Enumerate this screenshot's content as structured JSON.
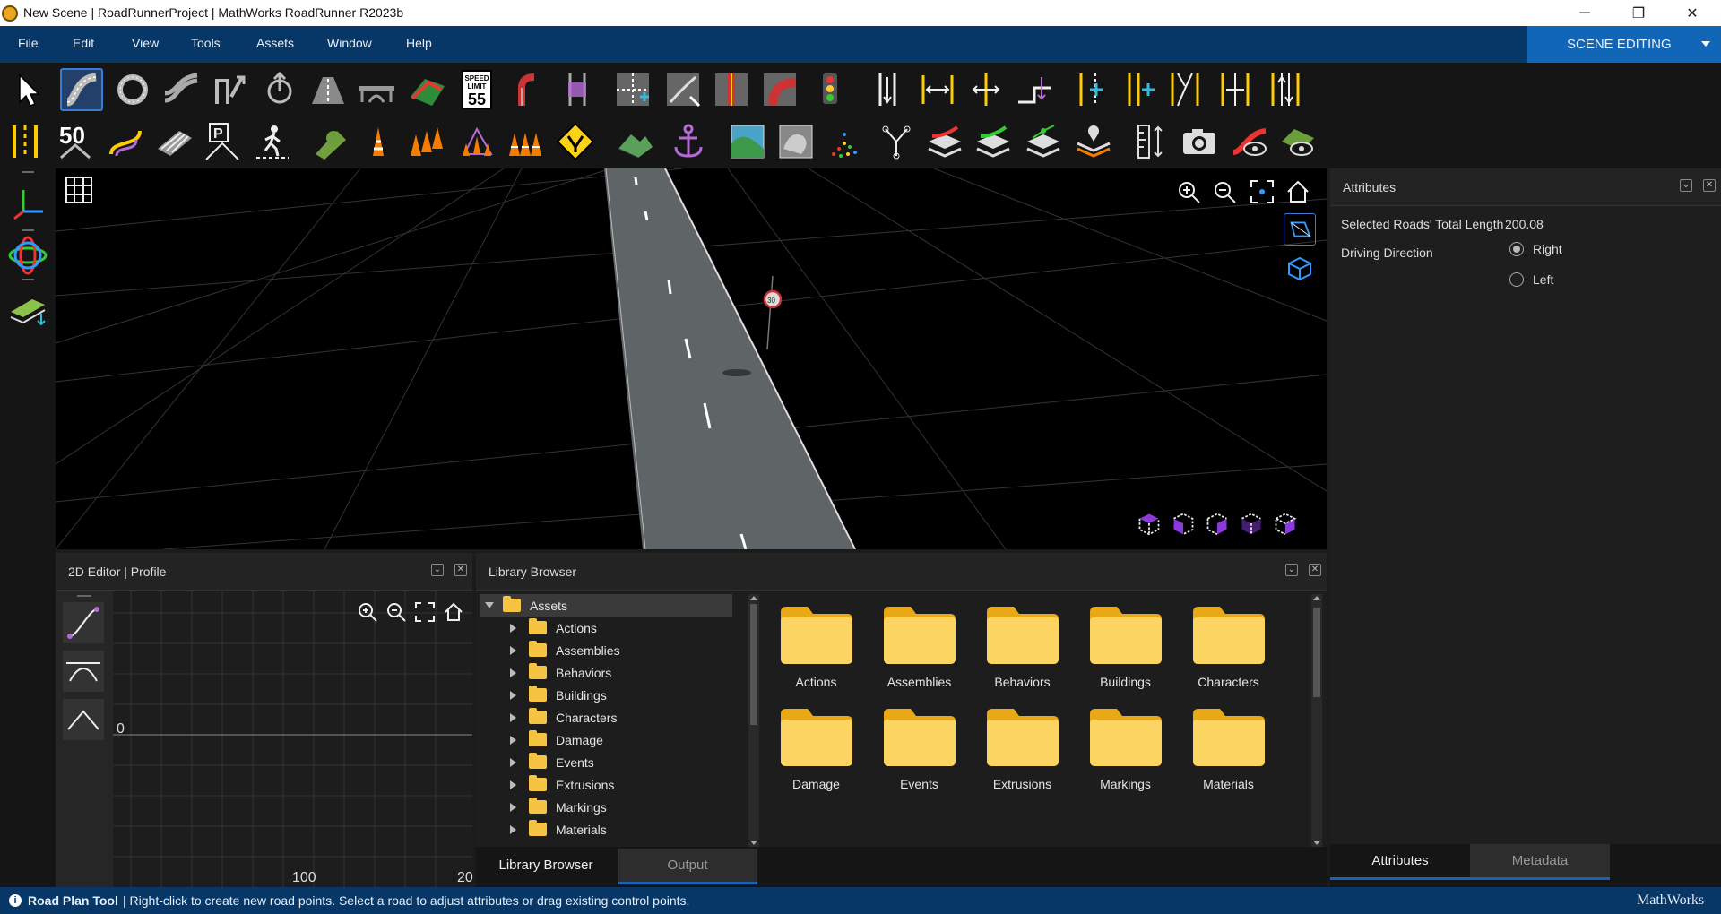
{
  "window": {
    "title": "New Scene | RoadRunnerProject | MathWorks RoadRunner R2023b",
    "controls": [
      "─",
      "❐",
      "✕"
    ]
  },
  "menu": {
    "items": [
      "File",
      "Edit",
      "View",
      "Tools",
      "Assets",
      "Window",
      "Help"
    ],
    "mode": "SCENE EDITING"
  },
  "toolbar": {
    "speed_sign": {
      "top": "SPEED",
      "mid": "LIMIT",
      "num": "55"
    },
    "speed_50": "50"
  },
  "viewport": {
    "sign_label": "30"
  },
  "attributes_panel": {
    "title": "Attributes",
    "total_length_label": "Selected Roads' Total Length",
    "total_length_value": "200.08",
    "driving_direction_label": "Driving Direction",
    "options": [
      "Right",
      "Left"
    ],
    "selected": "Right",
    "tabs": [
      "Attributes",
      "Metadata"
    ]
  },
  "editor_2d": {
    "title": "2D Editor | Profile",
    "axis_zero": "0",
    "axis_100": "100",
    "axis_200": "20"
  },
  "library": {
    "title": "Library Browser",
    "root": "Assets",
    "tree": [
      "Actions",
      "Assemblies",
      "Behaviors",
      "Buildings",
      "Characters",
      "Damage",
      "Events",
      "Extrusions",
      "Markings",
      "Materials"
    ],
    "grid": [
      "Actions",
      "Assemblies",
      "Behaviors",
      "Buildings",
      "Characters",
      "Damage",
      "Events",
      "Extrusions",
      "Markings",
      "Materials"
    ],
    "tabs": [
      "Library Browser",
      "Output"
    ]
  },
  "status": {
    "tool": "Road Plan Tool",
    "message": "| Right-click to create new road points. Select a road to adjust attributes or drag existing control points.",
    "brand": "MathWorks"
  },
  "colors": {
    "menubar": "#063767",
    "accent": "#1266b7",
    "folder": "#f6c342"
  }
}
